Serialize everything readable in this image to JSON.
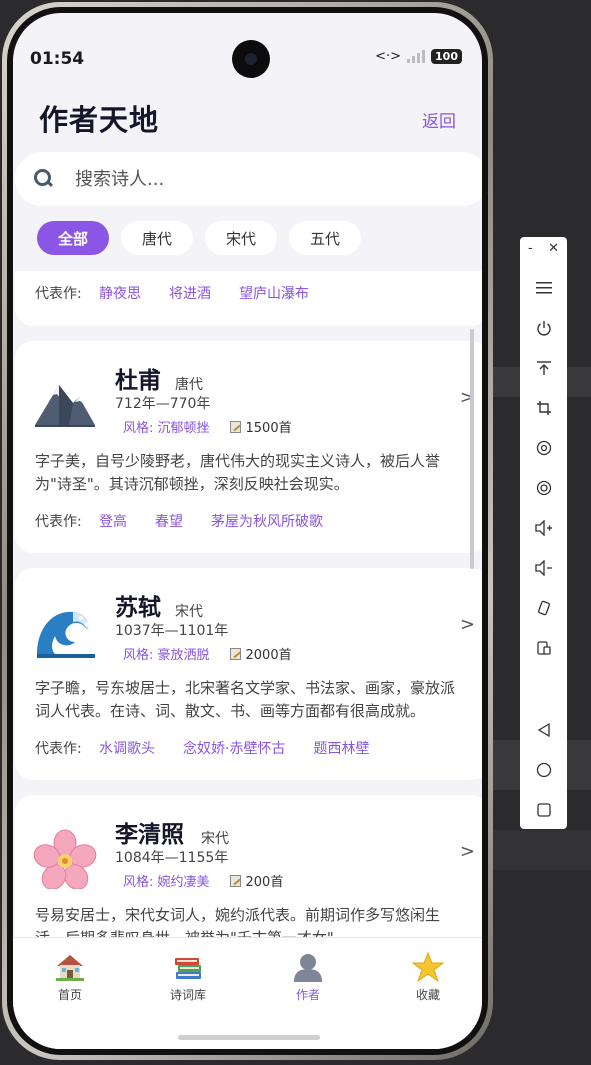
{
  "status_bar": {
    "time": "01:54",
    "battery": "100"
  },
  "header": {
    "title": "作者天地",
    "back_label": "返回"
  },
  "search": {
    "placeholder": "搜索诗人..."
  },
  "filters": [
    {
      "label": "全部",
      "active": true
    },
    {
      "label": "唐代",
      "active": false
    },
    {
      "label": "宋代",
      "active": false
    },
    {
      "label": "五代",
      "active": false
    }
  ],
  "partial_card": {
    "works_label": "代表作:",
    "works": [
      "静夜思",
      "将进酒",
      "望庐山瀑布"
    ]
  },
  "poets": [
    {
      "name": "杜甫",
      "dynasty": "唐代",
      "years": "712年—770年",
      "style": "风格: 沉郁顿挫",
      "poem_count": "1500首",
      "avatar_icon": "mountain-icon",
      "description": "字子美，自号少陵野老，唐代伟大的现实主义诗人，被后人誉为\"诗圣\"。其诗沉郁顿挫，深刻反映社会现实。",
      "works_label": "代表作:",
      "works": [
        "登高",
        "春望",
        "茅屋为秋风所破歌"
      ]
    },
    {
      "name": "苏轼",
      "dynasty": "宋代",
      "years": "1037年—1101年",
      "style": "风格: 豪放洒脱",
      "poem_count": "2000首",
      "avatar_icon": "wave-icon",
      "description": "字子瞻，号东坡居士，北宋著名文学家、书法家、画家，豪放派词人代表。在诗、词、散文、书、画等方面都有很高成就。",
      "works_label": "代表作:",
      "works": [
        "水调歌头",
        "念奴娇·赤壁怀古",
        "题西林壁"
      ]
    },
    {
      "name": "李清照",
      "dynasty": "宋代",
      "years": "1084年—1155年",
      "style": "风格: 婉约凄美",
      "poem_count": "200首",
      "avatar_icon": "cherry-blossom-icon",
      "description": "号易安居士，宋代女词人，婉约派代表。前期词作多写悠闲生活，后期多悲叹身世。被誉为\"千古第一才女\"。"
    }
  ],
  "chevron": ">",
  "bottom_nav": [
    {
      "label": "首页",
      "icon": "house-icon",
      "active": false
    },
    {
      "label": "诗词库",
      "icon": "books-icon",
      "active": false
    },
    {
      "label": "作者",
      "icon": "user-silhouette-icon",
      "active": true
    },
    {
      "label": "收藏",
      "icon": "star-icon",
      "active": false
    }
  ],
  "colors": {
    "accent": "#8b55e6",
    "background": "#f4f3f8",
    "card": "#ffffff"
  }
}
